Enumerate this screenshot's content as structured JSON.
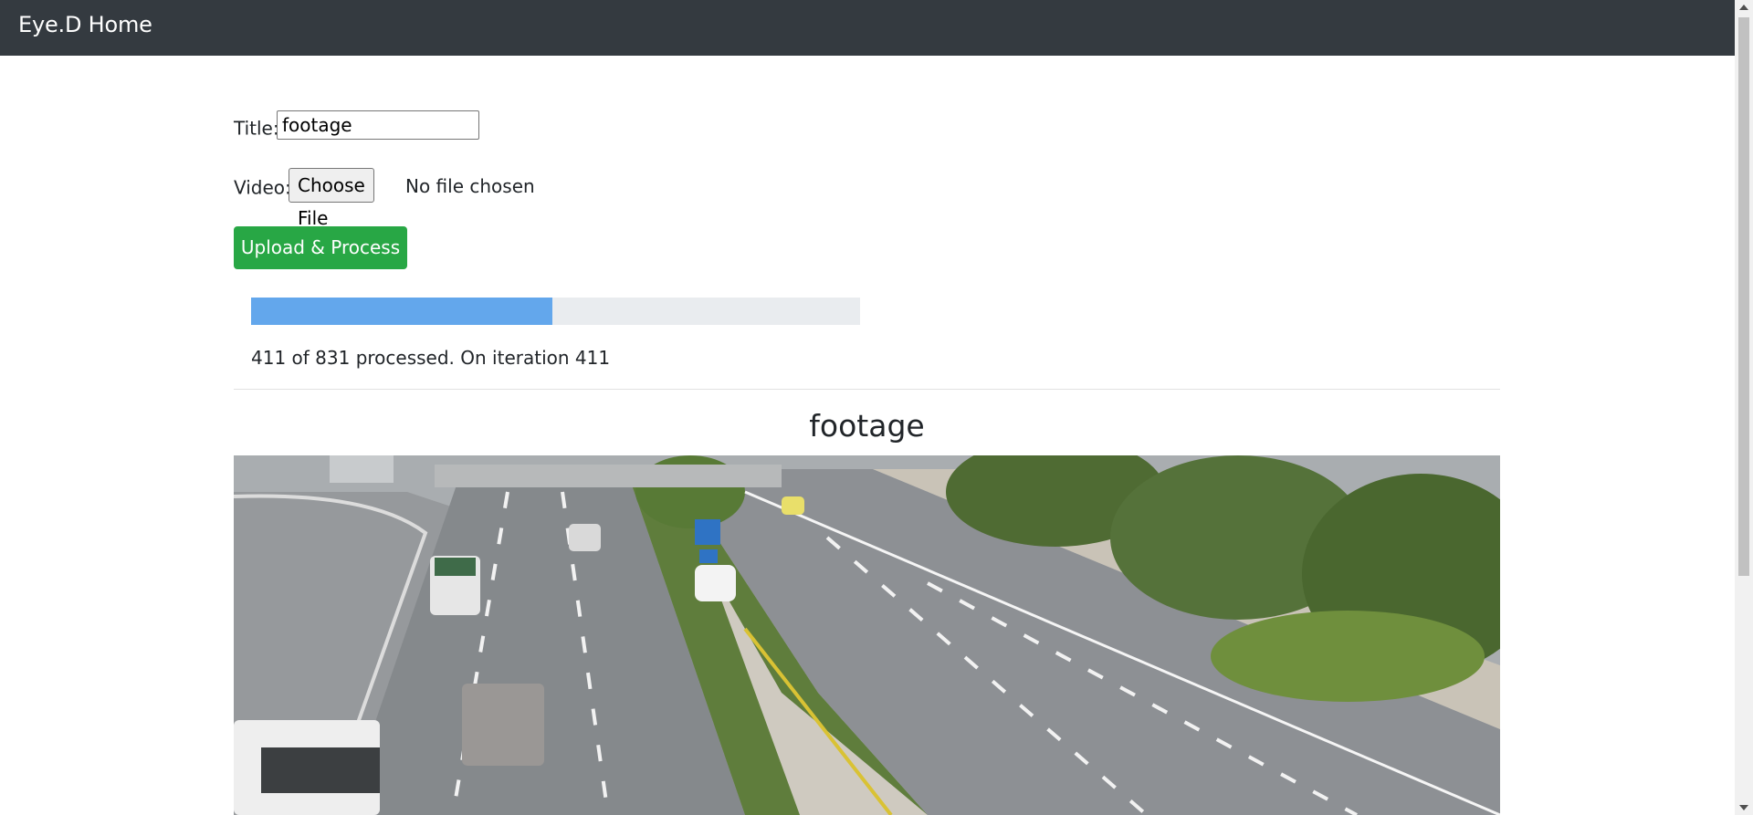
{
  "navbar": {
    "brand": "Eye.D Home"
  },
  "form": {
    "title_label": "Title:",
    "title_value": "footage",
    "video_label": "Video:",
    "choose_file_label": "Choose File",
    "file_status": "No file chosen",
    "upload_button": "Upload & Process"
  },
  "progress": {
    "fraction": 0.495,
    "text": "411 of 831 processed. On iteration 411"
  },
  "video": {
    "title": "footage"
  },
  "colors": {
    "navbar": "#343a40",
    "upload_button": "#28a745",
    "progress_fill": "#63a7ec"
  }
}
